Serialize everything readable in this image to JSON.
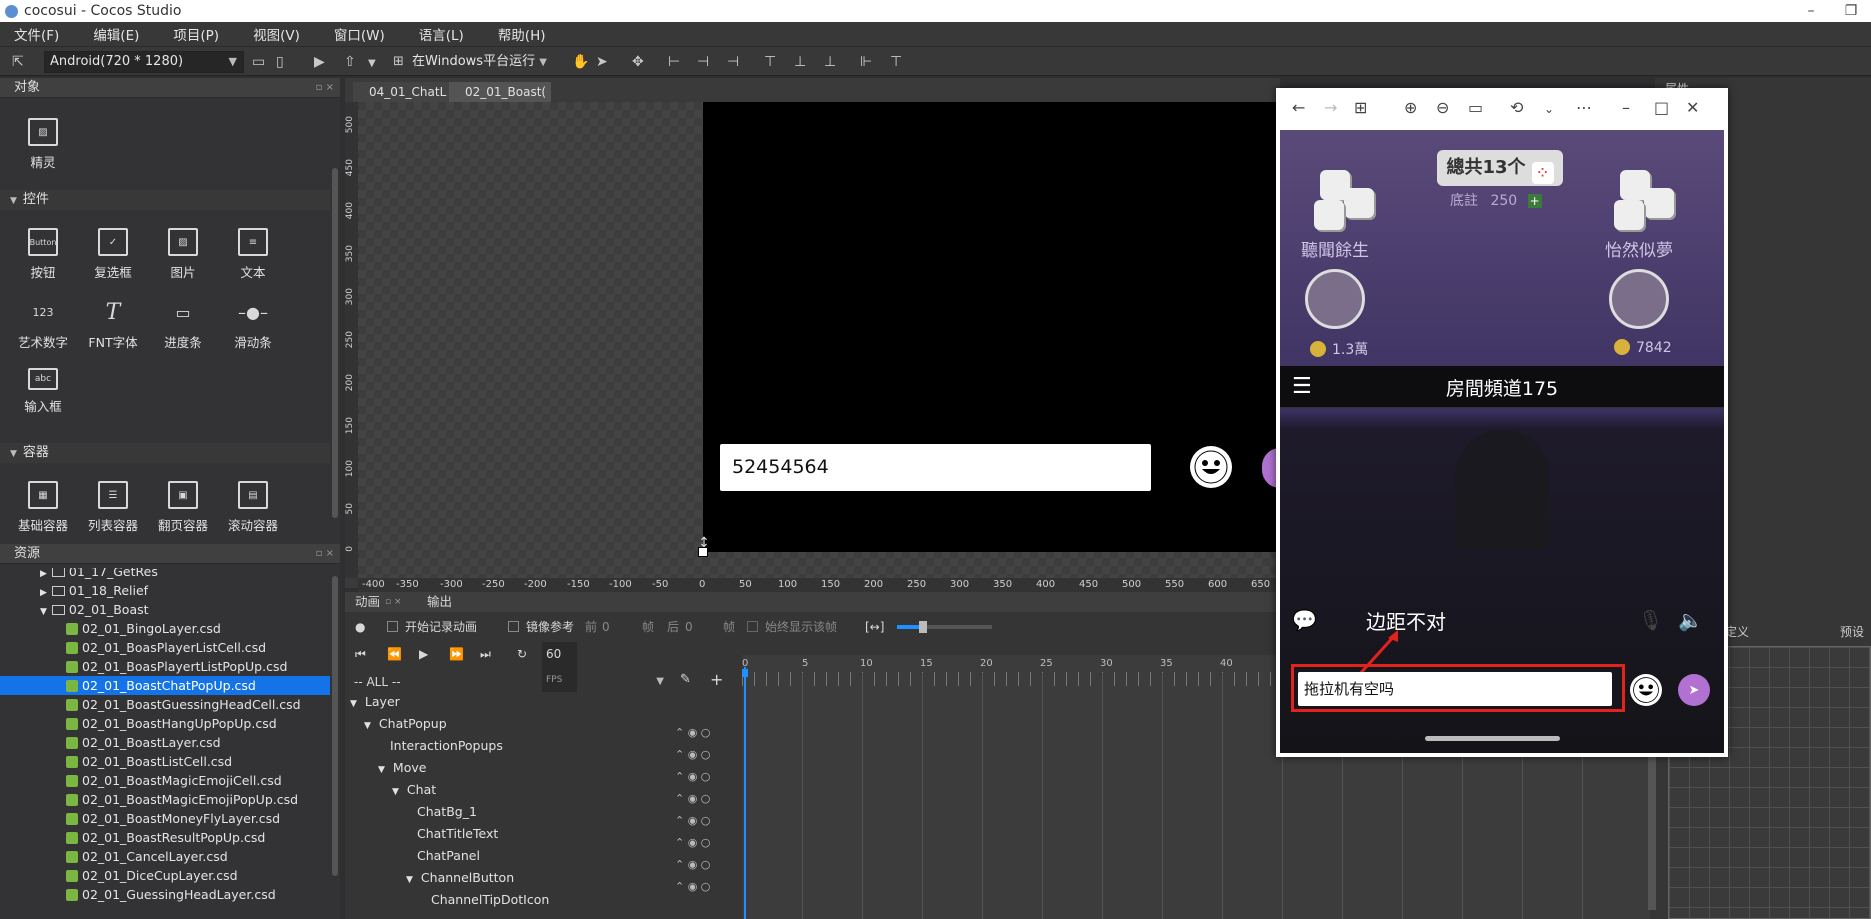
{
  "window": {
    "title": "cocosui - Cocos Studio",
    "controls": [
      "–",
      "❐"
    ]
  },
  "menu": [
    "文件(F)",
    "编辑(E)",
    "项目(P)",
    "视图(V)",
    "窗口(W)",
    "语言(L)",
    "帮助(H)"
  ],
  "toolbar": {
    "device": "Android(720 * 1280)",
    "run_label": "在Windows平台运行"
  },
  "objects_panel": {
    "title": "对象",
    "sprite_label": "精灵",
    "controls_section": "控件",
    "controls": [
      "按钮",
      "复选框",
      "图片",
      "文本",
      "艺术数字",
      "FNT字体",
      "进度条",
      "滑动条",
      "输入框"
    ],
    "containers_section": "容器",
    "containers": [
      "基础容器",
      "列表容器",
      "翻页容器",
      "滚动容器"
    ],
    "button_icon_text": "Button",
    "artnum_icon_text": "123",
    "input_icon_text": "abc"
  },
  "resources_panel": {
    "title": "资源",
    "folders": [
      "01_17_GetRes",
      "01_18_Relief",
      "02_01_Boast"
    ],
    "files": [
      "02_01_BingoLayer.csd",
      "02_01_BoasPlayerListCell.csd",
      "02_01_BoasPlayertListPopUp.csd",
      "02_01_BoastChatPopUp.csd",
      "02_01_BoastGuessingHeadCell.csd",
      "02_01_BoastHangUpPopUp.csd",
      "02_01_BoastLayer.csd",
      "02_01_BoastListCell.csd",
      "02_01_BoastMagicEmojiCell.csd",
      "02_01_BoastMagicEmojiPopUp.csd",
      "02_01_BoastMoneyFlyLayer.csd",
      "02_01_BoastResultPopUp.csd",
      "02_01_CancelLayer.csd",
      "02_01_DiceCupLayer.csd",
      "02_01_GuessingHeadLayer.csd"
    ],
    "selected_index": 3
  },
  "editor": {
    "tabs": [
      "04_01_ChatL",
      "02_01_Boast("
    ],
    "input_text": "52454564",
    "ruler_v": [
      "500",
      "450",
      "400",
      "350",
      "300",
      "250",
      "200",
      "150",
      "100",
      "50",
      "0"
    ],
    "ruler_h": [
      "-400",
      "-350",
      "-300",
      "-250",
      "-200",
      "-150",
      "-100",
      "-50",
      "0",
      "50",
      "100",
      "150",
      "200",
      "250",
      "300",
      "350",
      "400",
      "450",
      "500",
      "550",
      "600",
      "650"
    ]
  },
  "animation_panel": {
    "tabs": [
      "动画",
      "输出"
    ],
    "record_label": "开始记录动画",
    "mirror_label": "镜像参考",
    "prev_label": "前",
    "prev_val": "0",
    "frame_label": "帧",
    "next_label": "后",
    "next_val": "0",
    "frame_label2": "帧",
    "show_frame_label": "始终显示该帧",
    "fps": "60",
    "fps_unit": "FPS",
    "filter": "-- ALL --",
    "layers": [
      "Layer",
      "ChatPopup",
      "InteractionPopups",
      "Move",
      "Chat",
      "ChatBg_1",
      "ChatTitleText",
      "ChatPanel",
      "ChannelButton",
      "ChannelTipDotIcon"
    ],
    "timeline_marks": [
      "0",
      "5",
      "10",
      "15",
      "20",
      "25",
      "30",
      "35",
      "40"
    ]
  },
  "right_panel": {
    "title": "属性",
    "tab1": "定义",
    "tab2": "预设"
  },
  "preview": {
    "total": "總共13个",
    "bet_label": "底註",
    "bet_value": "250",
    "player_left": "聽聞餘生",
    "player_right": "怡然似夢",
    "coins_left": "1.3萬",
    "coins_right": "7842",
    "channel": "房間頻道175",
    "input_text": "拖拉机有空吗",
    "annotation": "边距不对"
  },
  "colors": {
    "accent": "#1e90ff",
    "selection": "#1473e6",
    "annotation": "#e2221c",
    "send": "#b071d0"
  }
}
